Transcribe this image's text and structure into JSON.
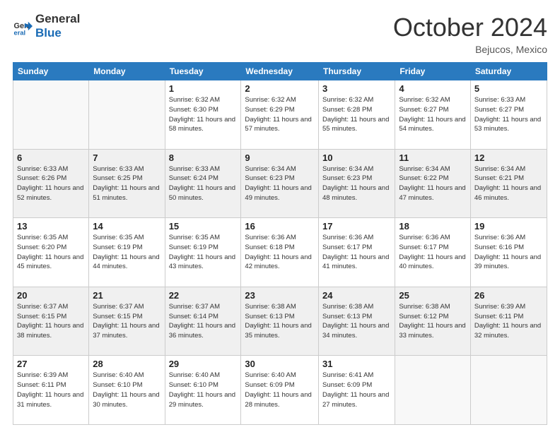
{
  "header": {
    "logo_general": "General",
    "logo_blue": "Blue",
    "month": "October 2024",
    "location": "Bejucos, Mexico"
  },
  "weekdays": [
    "Sunday",
    "Monday",
    "Tuesday",
    "Wednesday",
    "Thursday",
    "Friday",
    "Saturday"
  ],
  "weeks": [
    [
      {
        "day": "",
        "info": ""
      },
      {
        "day": "",
        "info": ""
      },
      {
        "day": "1",
        "info": "Sunrise: 6:32 AM\nSunset: 6:30 PM\nDaylight: 11 hours and 58 minutes."
      },
      {
        "day": "2",
        "info": "Sunrise: 6:32 AM\nSunset: 6:29 PM\nDaylight: 11 hours and 57 minutes."
      },
      {
        "day": "3",
        "info": "Sunrise: 6:32 AM\nSunset: 6:28 PM\nDaylight: 11 hours and 55 minutes."
      },
      {
        "day": "4",
        "info": "Sunrise: 6:32 AM\nSunset: 6:27 PM\nDaylight: 11 hours and 54 minutes."
      },
      {
        "day": "5",
        "info": "Sunrise: 6:33 AM\nSunset: 6:27 PM\nDaylight: 11 hours and 53 minutes."
      }
    ],
    [
      {
        "day": "6",
        "info": "Sunrise: 6:33 AM\nSunset: 6:26 PM\nDaylight: 11 hours and 52 minutes."
      },
      {
        "day": "7",
        "info": "Sunrise: 6:33 AM\nSunset: 6:25 PM\nDaylight: 11 hours and 51 minutes."
      },
      {
        "day": "8",
        "info": "Sunrise: 6:33 AM\nSunset: 6:24 PM\nDaylight: 11 hours and 50 minutes."
      },
      {
        "day": "9",
        "info": "Sunrise: 6:34 AM\nSunset: 6:23 PM\nDaylight: 11 hours and 49 minutes."
      },
      {
        "day": "10",
        "info": "Sunrise: 6:34 AM\nSunset: 6:23 PM\nDaylight: 11 hours and 48 minutes."
      },
      {
        "day": "11",
        "info": "Sunrise: 6:34 AM\nSunset: 6:22 PM\nDaylight: 11 hours and 47 minutes."
      },
      {
        "day": "12",
        "info": "Sunrise: 6:34 AM\nSunset: 6:21 PM\nDaylight: 11 hours and 46 minutes."
      }
    ],
    [
      {
        "day": "13",
        "info": "Sunrise: 6:35 AM\nSunset: 6:20 PM\nDaylight: 11 hours and 45 minutes."
      },
      {
        "day": "14",
        "info": "Sunrise: 6:35 AM\nSunset: 6:19 PM\nDaylight: 11 hours and 44 minutes."
      },
      {
        "day": "15",
        "info": "Sunrise: 6:35 AM\nSunset: 6:19 PM\nDaylight: 11 hours and 43 minutes."
      },
      {
        "day": "16",
        "info": "Sunrise: 6:36 AM\nSunset: 6:18 PM\nDaylight: 11 hours and 42 minutes."
      },
      {
        "day": "17",
        "info": "Sunrise: 6:36 AM\nSunset: 6:17 PM\nDaylight: 11 hours and 41 minutes."
      },
      {
        "day": "18",
        "info": "Sunrise: 6:36 AM\nSunset: 6:17 PM\nDaylight: 11 hours and 40 minutes."
      },
      {
        "day": "19",
        "info": "Sunrise: 6:36 AM\nSunset: 6:16 PM\nDaylight: 11 hours and 39 minutes."
      }
    ],
    [
      {
        "day": "20",
        "info": "Sunrise: 6:37 AM\nSunset: 6:15 PM\nDaylight: 11 hours and 38 minutes."
      },
      {
        "day": "21",
        "info": "Sunrise: 6:37 AM\nSunset: 6:15 PM\nDaylight: 11 hours and 37 minutes."
      },
      {
        "day": "22",
        "info": "Sunrise: 6:37 AM\nSunset: 6:14 PM\nDaylight: 11 hours and 36 minutes."
      },
      {
        "day": "23",
        "info": "Sunrise: 6:38 AM\nSunset: 6:13 PM\nDaylight: 11 hours and 35 minutes."
      },
      {
        "day": "24",
        "info": "Sunrise: 6:38 AM\nSunset: 6:13 PM\nDaylight: 11 hours and 34 minutes."
      },
      {
        "day": "25",
        "info": "Sunrise: 6:38 AM\nSunset: 6:12 PM\nDaylight: 11 hours and 33 minutes."
      },
      {
        "day": "26",
        "info": "Sunrise: 6:39 AM\nSunset: 6:11 PM\nDaylight: 11 hours and 32 minutes."
      }
    ],
    [
      {
        "day": "27",
        "info": "Sunrise: 6:39 AM\nSunset: 6:11 PM\nDaylight: 11 hours and 31 minutes."
      },
      {
        "day": "28",
        "info": "Sunrise: 6:40 AM\nSunset: 6:10 PM\nDaylight: 11 hours and 30 minutes."
      },
      {
        "day": "29",
        "info": "Sunrise: 6:40 AM\nSunset: 6:10 PM\nDaylight: 11 hours and 29 minutes."
      },
      {
        "day": "30",
        "info": "Sunrise: 6:40 AM\nSunset: 6:09 PM\nDaylight: 11 hours and 28 minutes."
      },
      {
        "day": "31",
        "info": "Sunrise: 6:41 AM\nSunset: 6:09 PM\nDaylight: 11 hours and 27 minutes."
      },
      {
        "day": "",
        "info": ""
      },
      {
        "day": "",
        "info": ""
      }
    ]
  ]
}
